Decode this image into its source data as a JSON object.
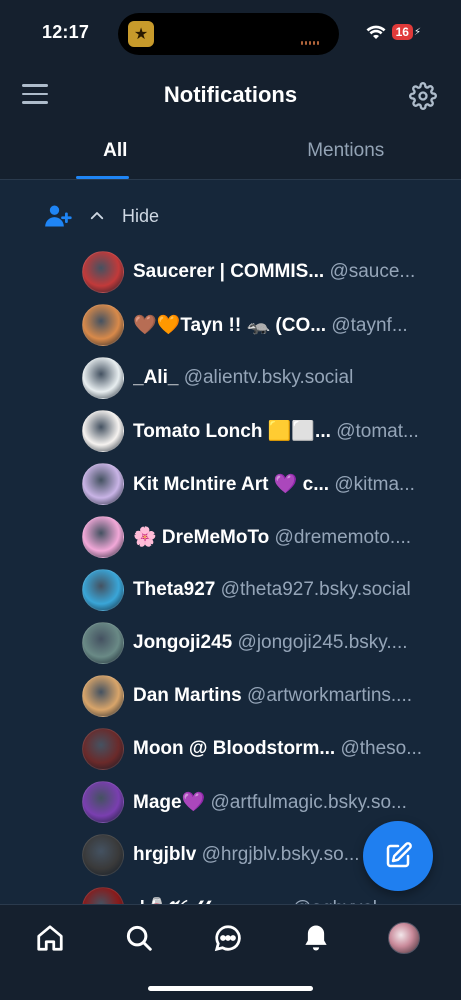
{
  "status_bar": {
    "time": "12:17",
    "battery": "16"
  },
  "header": {
    "title": "Notifications"
  },
  "tabs": [
    {
      "label": "All",
      "active": true
    },
    {
      "label": "Mentions",
      "active": false
    }
  ],
  "group": {
    "hide_label": "Hide"
  },
  "users": [
    {
      "name": "Saucerer | COMMIS...",
      "handle": "@sauce...",
      "bg": "#c23a3a"
    },
    {
      "name": "🤎🧡Tayn !! 🦡 (CO...",
      "handle": "@taynf...",
      "bg": "#d98a4a"
    },
    {
      "name": "_Ali_",
      "handle": "@alientv.bsky.social",
      "bg": "#e8eef0"
    },
    {
      "name": "Tomato Lonch 🟨⬜...",
      "handle": "@tomat...",
      "bg": "#f6f3f0"
    },
    {
      "name": "Kit McIntire Art 💜 c...",
      "handle": "@kitma...",
      "bg": "#c9b4e6"
    },
    {
      "name": "🌸 DreMeMoTo",
      "handle": "@drememoto....",
      "bg": "#f2a8d8"
    },
    {
      "name": "Theta927",
      "handle": "@theta927.bsky.social",
      "bg": "#3aa6d8"
    },
    {
      "name": "Jongoji245",
      "handle": "@jongoji245.bsky....",
      "bg": "#6a8a86"
    },
    {
      "name": "Dan Martins",
      "handle": "@artworkmartins....",
      "bg": "#d9a56a"
    },
    {
      "name": "Moon @ Bloodstorm...",
      "handle": "@theso...",
      "bg": "#6b2a2a"
    },
    {
      "name": "Mage💜",
      "handle": "@artfulmagic.bsky.so...",
      "bg": "#7a3fb0"
    },
    {
      "name": "hrgjblv",
      "handle": "@hrgjblv.bsky.so...",
      "bg": "#3a3a3a"
    },
    {
      "name": "•|🍷𝓥𝓸𝓵𝓴𝓸𝓶𝓮𝓷𝓷...",
      "handle": "@aghvvol...",
      "bg": "#8a1a1a"
    }
  ],
  "icons": {
    "menu": "menu-icon",
    "settings": "gear-icon",
    "person_add": "person-add-icon",
    "chevron": "chevron-up-icon",
    "compose": "compose-icon",
    "home": "home-icon",
    "search": "search-icon",
    "chat": "chat-icon",
    "bell": "bell-icon"
  },
  "colors": {
    "accent": "#1f85f5",
    "background": "#16273a",
    "bar": "#15202e"
  }
}
